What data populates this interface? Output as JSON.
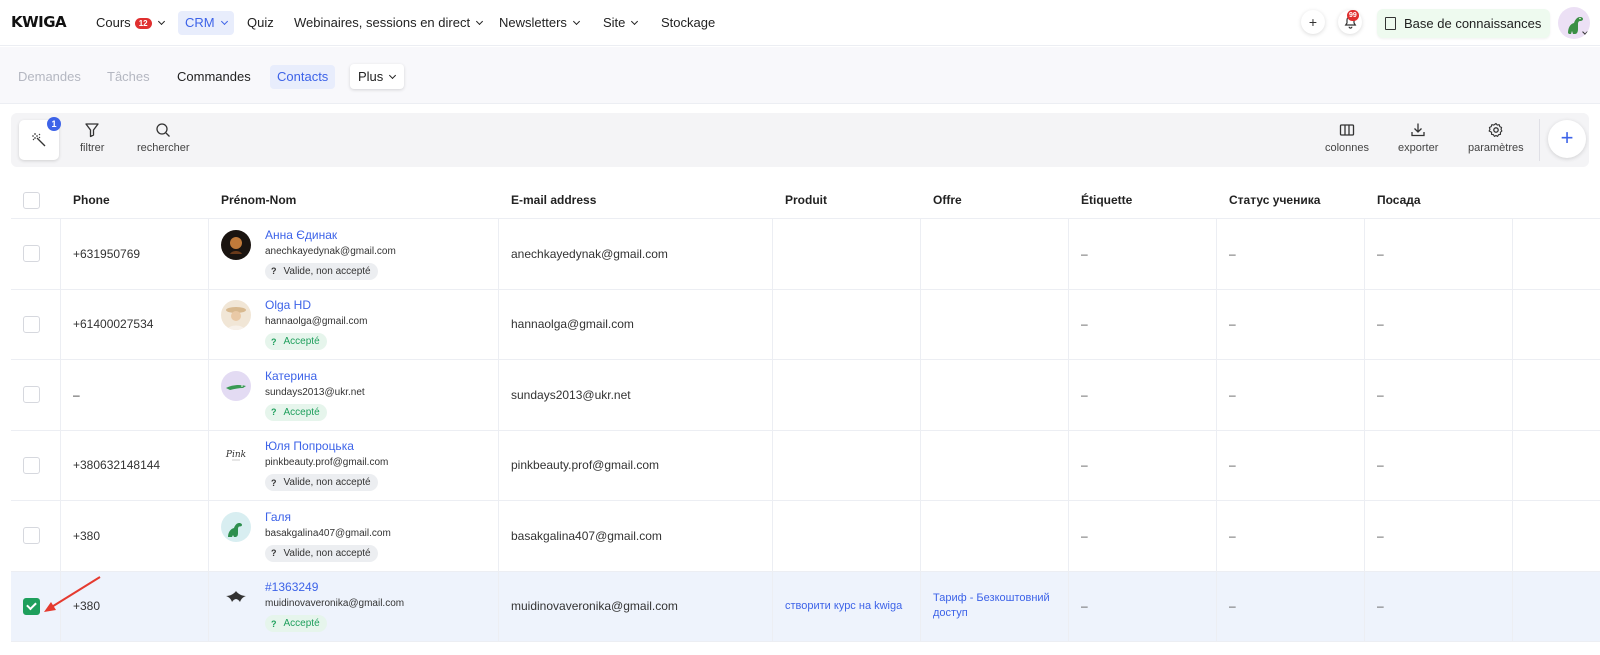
{
  "top": {
    "logo": "KWIGA",
    "nav": [
      {
        "label": "Cours",
        "badge": "12"
      },
      {
        "label": "CRM"
      },
      {
        "label": "Quiz"
      },
      {
        "label": "Webinaires, sessions en direct"
      },
      {
        "label": "Newsletters"
      },
      {
        "label": "Site"
      },
      {
        "label": "Stockage"
      }
    ],
    "bell_count": "99",
    "kb_label": "Base de connaissances"
  },
  "subnav": {
    "items": [
      "Demandes",
      "Tâches",
      "Commandes",
      "Contacts"
    ],
    "more": "Plus"
  },
  "toolbar": {
    "wand_badge": "1",
    "filter": "filtrer",
    "search": "rechercher",
    "columns": "colonnes",
    "export": "exporter",
    "settings": "paramètres",
    "add": "+"
  },
  "table": {
    "headers": [
      "Phone",
      "Prénom-Nom",
      "E-mail address",
      "Produit",
      "Offre",
      "Étiquette",
      "Статус ученика",
      "Посада"
    ],
    "rows": [
      {
        "checked": false,
        "phone": "+631950769",
        "name": "Анна Єдинак",
        "email": "anechkayedynak@gmail.com",
        "tag": "Valide, non accepté",
        "tag_color": "grey",
        "email2": "anechkayedynak@gmail.com",
        "product": "",
        "offer": "",
        "label": "–",
        "status": "–",
        "position": "–"
      },
      {
        "checked": false,
        "phone": "+61400027534",
        "name": "Olga HD",
        "email": "hannaolga@gmail.com",
        "tag": "Accepté",
        "tag_color": "green",
        "email2": "hannaolga@gmail.com",
        "product": "",
        "offer": "",
        "label": "–",
        "status": "–",
        "position": "–"
      },
      {
        "checked": false,
        "phone": "–",
        "name": "Катерина",
        "email": "sundays2013@ukr.net",
        "tag": "Accepté",
        "tag_color": "green",
        "email2": "sundays2013@ukr.net",
        "product": "",
        "offer": "",
        "label": "–",
        "status": "–",
        "position": "–"
      },
      {
        "checked": false,
        "phone": "+380632148144",
        "name": "Юля Попроцька",
        "email": "pinkbeauty.prof@gmail.com",
        "tag": "Valide, non accepté",
        "tag_color": "grey",
        "email2": "pinkbeauty.prof@gmail.com",
        "product": "",
        "offer": "",
        "label": "–",
        "status": "–",
        "position": "–"
      },
      {
        "checked": false,
        "phone": "+380",
        "name": "Галя",
        "email": "basakgalina407@gmail.com",
        "tag": "Valide, non accepté",
        "tag_color": "grey",
        "email2": "basakgalina407@gmail.com",
        "product": "",
        "offer": "",
        "label": "–",
        "status": "–",
        "position": "–"
      },
      {
        "checked": true,
        "phone": "+380",
        "name": "#1363249",
        "email": "muidinovaveronika@gmail.com",
        "tag": "Accepté",
        "tag_color": "green",
        "email2": "muidinovaveronika@gmail.com",
        "product": "створити курс на kwiga",
        "offer": "Тариф - Безкоштовний доступ",
        "label": "–",
        "status": "–",
        "position": "–"
      }
    ],
    "tag_q": "?"
  },
  "colors": {
    "accent": "#3d63e8",
    "green": "#1e9f5c",
    "red": "#e02f2f",
    "arrow": "#e53a2f"
  },
  "avatar_logo_text": "Pink"
}
